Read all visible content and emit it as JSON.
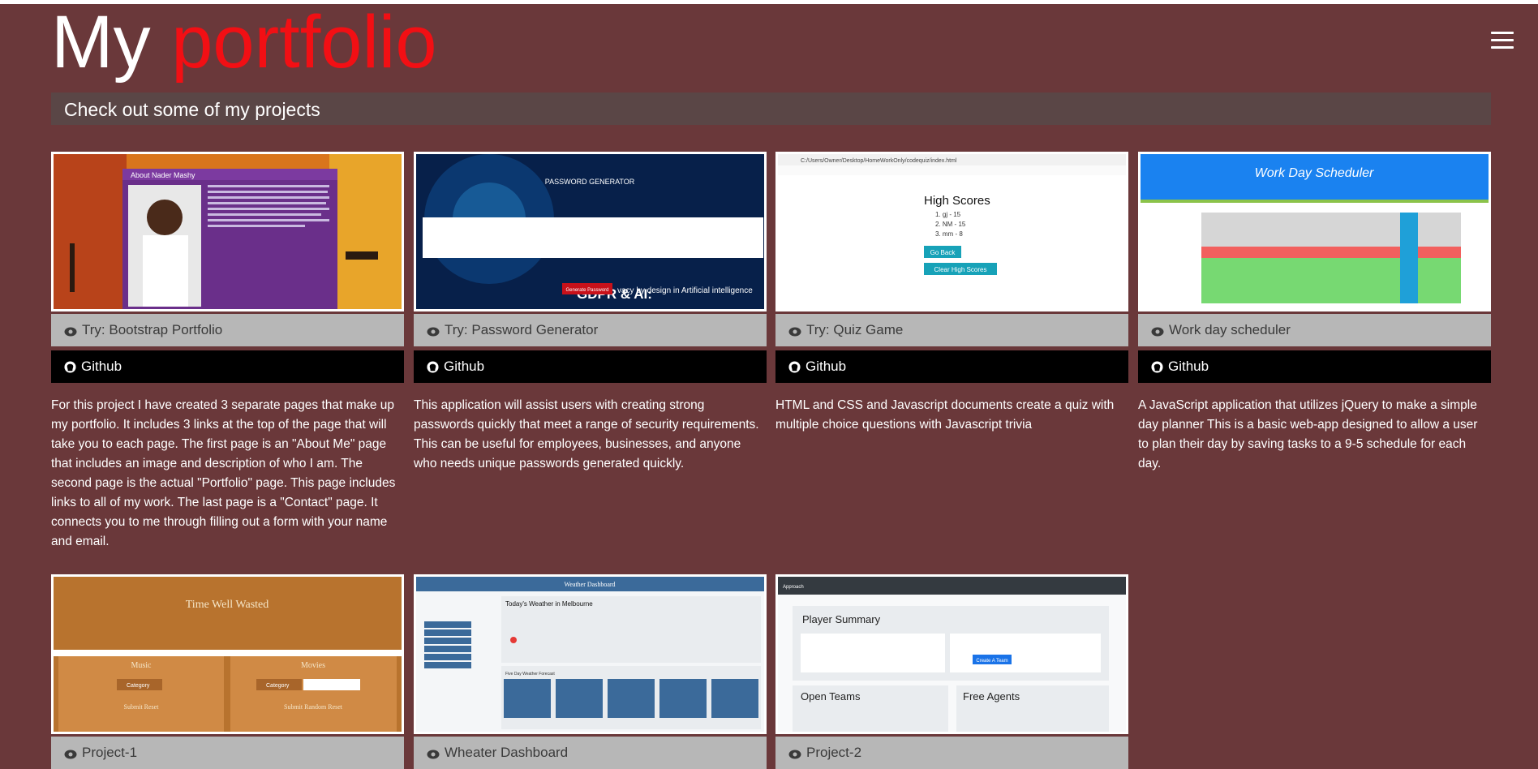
{
  "header": {
    "title_word1": "My",
    "title_word2": "portfolio",
    "subtitle": "Check out some of my projects"
  },
  "colors": {
    "background": "#6a383a",
    "accent": "#f20f14",
    "try_button": "#b7b7b7",
    "github_button": "#000000"
  },
  "projects": [
    {
      "try_label": "Try: Bootstrap Portfolio",
      "github_label": "Github",
      "description": "For this project I have created 3 separate pages that make up my portfolio. It includes 3 links at the top of the page that will take you to each page. The first page is an \"About Me\" page that includes an image and description of who I am. The second page is the actual \"Portfolio\" page. This page includes links to all of my work. The last page is a \"Contact\" page. It connects you to me through filling out a form with your name and email.",
      "thumb": {
        "heading": "About Nader Mashy"
      }
    },
    {
      "try_label": "Try: Password Generator",
      "github_label": "Github",
      "description": "This application will assist users with creating strong passwords quickly that meet a range of security requirements. This can be useful for employees, businesses, and anyone who needs unique passwords generated quickly.",
      "thumb": {
        "heading": "PASSWORD GENERATOR",
        "banner": "GDPR & AI:",
        "banner_sub": "vacy by design in Artificial intelligence",
        "button": "Generate Password"
      }
    },
    {
      "try_label": "Try: Quiz Game",
      "github_label": "Github",
      "description": "HTML and CSS and Javascript documents create a quiz with multiple choice questions with Javascript trivia",
      "thumb": {
        "path": "C:/Users/Owner/Desktop/HomeWorkOnly/codequiz/index.html",
        "heading": "High Scores",
        "items": [
          "1. gj - 15",
          "2. NM - 15",
          "3. mm - 8"
        ],
        "btn1": "Go Back",
        "btn2": "Clear High Scores"
      }
    },
    {
      "try_label": "Work day scheduler",
      "github_label": "Github",
      "description": "A JavaScript application that utilizes jQuery to make a simple day planner This is a basic web-app designed to allow a user to plan their day by saving tasks to a 9-5 schedule for each day.",
      "thumb": {
        "heading": "Work Day Scheduler"
      }
    },
    {
      "try_label": "Project-1",
      "thumb": {
        "heading": "Time Well Wasted",
        "left": "Music",
        "right": "Movies",
        "select": "Category",
        "btns_left": "Submit Reset",
        "btns_right": "Submit Random Reset"
      }
    },
    {
      "try_label": "Wheater Dashboard",
      "thumb": {
        "heading": "Weather Dashboard",
        "city_title": "Today's Weather in Melbourne",
        "forecast": "Five Day Weather Forecast"
      }
    },
    {
      "try_label": "Project-2",
      "thumb": {
        "nav": "Approach",
        "heading": "Player Summary",
        "team_btn": "Create A Team",
        "col1": "Open Teams",
        "col2": "Free Agents"
      }
    }
  ]
}
